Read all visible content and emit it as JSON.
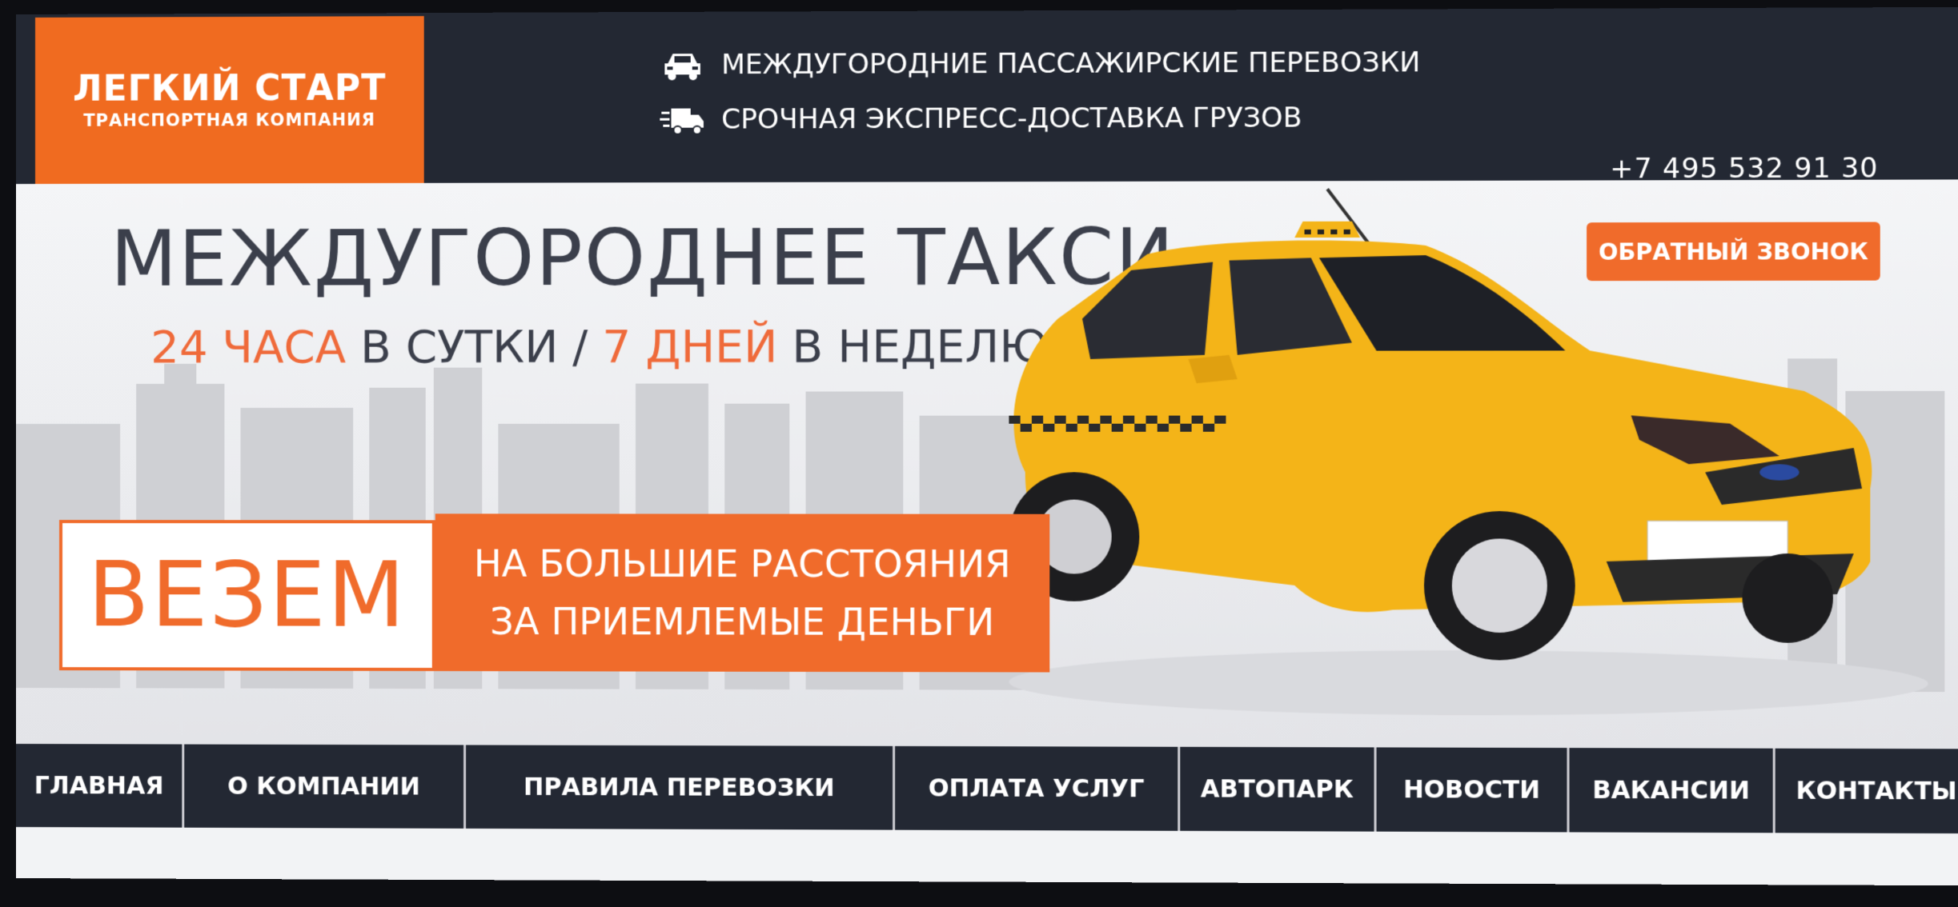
{
  "header": {
    "logo_title": "ЛЕГКИЙ СТАРТ",
    "logo_subtitle": "ТРАНСПОРТНАЯ КОМПАНИЯ",
    "services": [
      {
        "icon": "car-icon",
        "label": "МЕЖДУГОРОДНИЕ ПАССАЖИРСКИЕ ПЕРЕВОЗКИ"
      },
      {
        "icon": "delivery-truck-icon",
        "label": "СРОЧНАЯ ЭКСПРЕСС-ДОСТАВКА ГРУЗОВ"
      }
    ],
    "phone": "+7 495 532 91 30"
  },
  "hero": {
    "headline": "МЕЖДУГОРОДНЕЕ ТАКСИ",
    "subline_hours": "24 ЧАСА",
    "subline_mid": " В СУТКИ / ",
    "subline_days": "7 ДНЕЙ",
    "subline_end": " В НЕДЕЛЮ",
    "callback_label": "ОБРАТНЫЙ ЗВОНОК",
    "promo_word": "ВЕЗЕМ",
    "promo_line1": "НА БОЛЬШИЕ РАССТОЯНИЯ",
    "promo_line2": "ЗА ПРИЕМЛЕМЫЕ ДЕНЬГИ"
  },
  "nav": {
    "items": [
      "ГЛАВНАЯ",
      "О КОМПАНИИ",
      "ПРАВИЛА ПЕРЕВОЗКИ",
      "ОПЛАТА УСЛУГ",
      "АВТОПАРК",
      "НОВОСТИ",
      "ВАКАНСИИ",
      "КОНТАКТЫ"
    ]
  },
  "colors": {
    "accent": "#f06b2b",
    "header_bg": "#232833",
    "taxi_yellow": "#f4b418"
  }
}
